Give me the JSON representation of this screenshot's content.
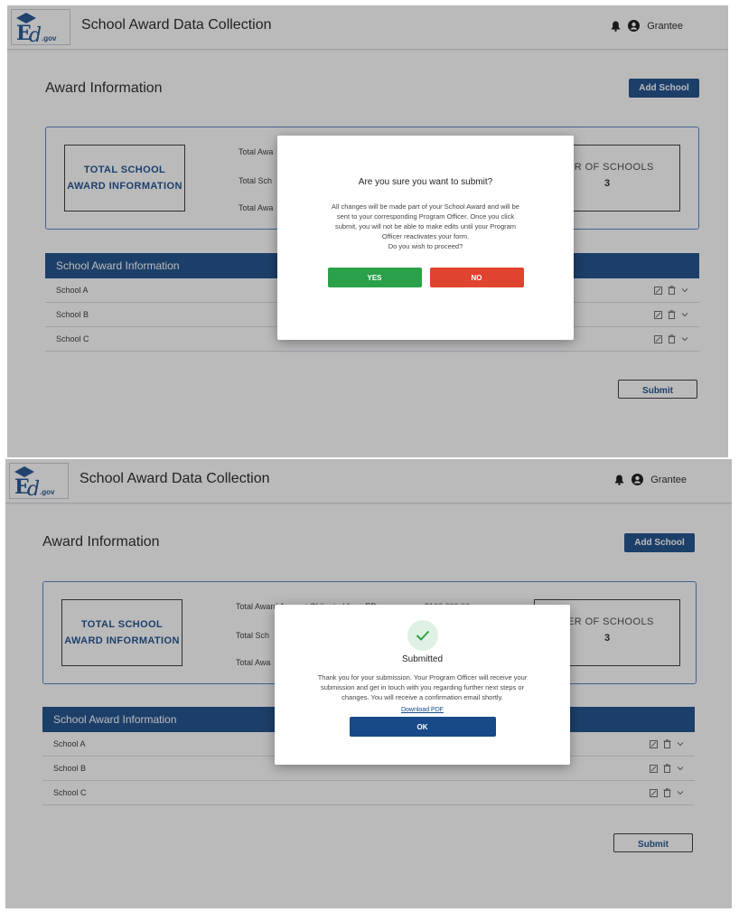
{
  "app": {
    "logo_text": "ED.gov",
    "title": "School Award Data Collection",
    "user": "Grantee"
  },
  "page": {
    "heading": "Award Information",
    "add_school": "Add School",
    "total_box_line1": "TOTAL SCHOOL",
    "total_box_line2": "AWARD INFORMATION",
    "summary_labels": [
      "Total Awa",
      "Total Sch",
      "Total Awa"
    ],
    "summary_labels_s2": [
      "Total Award Amount Obligated from ED",
      "Total Sch",
      "Total Awa"
    ],
    "summary_amount_partial": "$100,000.00",
    "count_title": "BER OF SCHOOLS",
    "count_value": "3",
    "table_title": "School Award Information",
    "schools": [
      "School A",
      "School B",
      "School C"
    ],
    "submit": "Submit"
  },
  "confirm_dialog": {
    "title": "Are you sure you want to submit?",
    "body_line1": "All changes will be made part of your School Award and will be",
    "body_line2": "sent to your corresponding Program Officer. Once you click",
    "body_line3": "submit, you will not be able to make edits until your Program",
    "body_line4": "Officer reactivates your form.",
    "body_line5": "Do you wish to proceed?",
    "yes": "YES",
    "no": "NO"
  },
  "submitted_dialog": {
    "title": "Submitted",
    "body_line1": "Thank you for your submission. Your Program Officer will receive your",
    "body_line2": "submission and get in touch with you regarding further next steps or",
    "body_line3": "changes. You will receive a confirmation email shortly.",
    "link": "Download PDF",
    "ok": "OK"
  },
  "colors": {
    "brand_blue": "#174a87",
    "yes_green": "#2aa148",
    "no_red": "#e0432f"
  }
}
